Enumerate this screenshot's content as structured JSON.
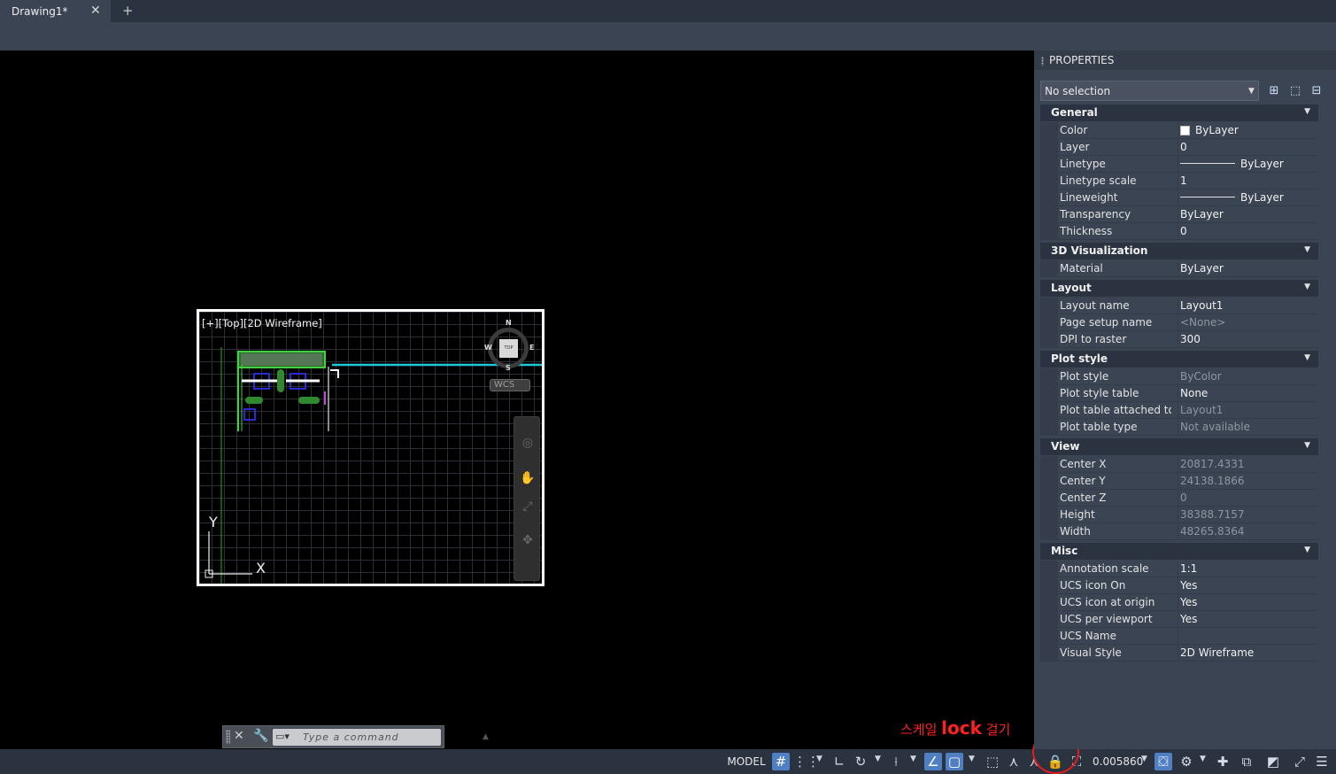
{
  "tabs": {
    "active_title": "Drawing1*",
    "close_glyph": "✕",
    "add_glyph": "+"
  },
  "viewport": {
    "label": "[+][Top][2D Wireframe]",
    "compass": {
      "north": "N",
      "south": "S",
      "east": "E",
      "west": "W",
      "top_face": "TOP"
    },
    "ucs_button": "WCS",
    "axis_x": "X",
    "axis_y": "Y"
  },
  "command_line": {
    "placeholder": "Type a command"
  },
  "annotation": {
    "prefix": "스케일 ",
    "bold": "lock",
    "suffix": " 걸기",
    "color": "#ff2020"
  },
  "statusbar": {
    "model_label": "MODEL",
    "annotation_scale_value": "0.005860",
    "icons": [
      "grid-icon",
      "snap-icon",
      "ortho-icon",
      "polar-icon",
      "osnap-track-icon",
      "dynamic-input-icon",
      "osnap-icon",
      "selection-cycling-icon",
      "annotation-visibility-icon",
      "auto-scale-icon",
      "lock-icon",
      "maximize-viewport-icon",
      "annotation-monitor-icon",
      "workspace-gear-icon",
      "plus-icon",
      "isolate-icon",
      "hardware-accel-icon",
      "fullscreen-icon",
      "customize-menu-icon"
    ]
  },
  "properties": {
    "title": "PROPERTIES",
    "selection": "No selection",
    "sections": [
      {
        "name": "General",
        "rows": [
          {
            "name": "Color",
            "value": "ByLayer",
            "swatch": "#ffffff"
          },
          {
            "name": "Layer",
            "value": "0"
          },
          {
            "name": "Linetype",
            "value": "ByLayer",
            "line": true
          },
          {
            "name": "Linetype scale",
            "value": "1"
          },
          {
            "name": "Lineweight",
            "value": "ByLayer",
            "line": true
          },
          {
            "name": "Transparency",
            "value": "ByLayer"
          },
          {
            "name": "Thickness",
            "value": "0"
          }
        ]
      },
      {
        "name": "3D Visualization",
        "rows": [
          {
            "name": "Material",
            "value": "ByLayer"
          }
        ]
      },
      {
        "name": "Layout",
        "rows": [
          {
            "name": "Layout name",
            "value": "Layout1"
          },
          {
            "name": "Page setup name",
            "value": "<None>",
            "dim": true
          },
          {
            "name": "DPI to raster",
            "value": "300"
          }
        ]
      },
      {
        "name": "Plot style",
        "rows": [
          {
            "name": "Plot style",
            "value": "ByColor",
            "dim": true
          },
          {
            "name": "Plot style table",
            "value": "None"
          },
          {
            "name": "Plot table attached to",
            "value": "Layout1",
            "dim": true
          },
          {
            "name": "Plot table type",
            "value": "Not available",
            "dim": true
          }
        ]
      },
      {
        "name": "View",
        "rows": [
          {
            "name": "Center X",
            "value": "20817.4331",
            "dim": true
          },
          {
            "name": "Center Y",
            "value": "24138.1866",
            "dim": true
          },
          {
            "name": "Center Z",
            "value": "0",
            "dim": true
          },
          {
            "name": "Height",
            "value": "38388.7157",
            "dim": true
          },
          {
            "name": "Width",
            "value": "48265.8364",
            "dim": true
          }
        ]
      },
      {
        "name": "Misc",
        "rows": [
          {
            "name": "Annotation scale",
            "value": "1:1"
          },
          {
            "name": "UCS icon On",
            "value": "Yes"
          },
          {
            "name": "UCS icon at origin",
            "value": "Yes"
          },
          {
            "name": "UCS per viewport",
            "value": "Yes"
          },
          {
            "name": "UCS Name",
            "value": ""
          },
          {
            "name": "Visual Style",
            "value": "2D Wireframe"
          }
        ]
      }
    ]
  }
}
